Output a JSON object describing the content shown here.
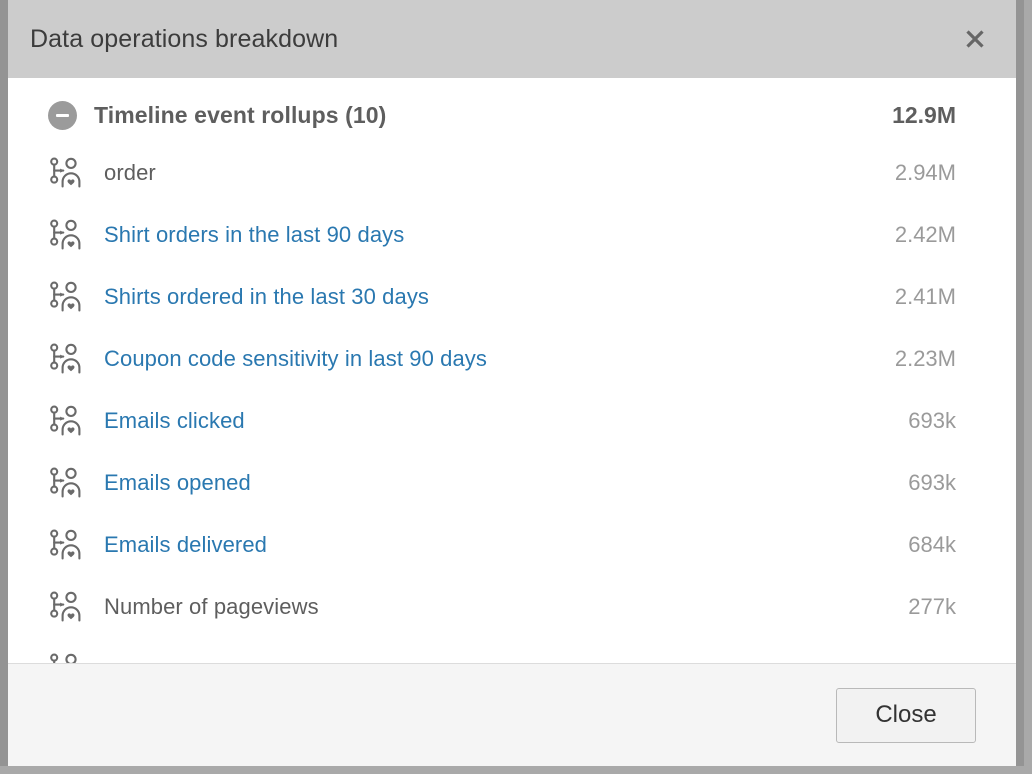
{
  "window": {
    "title": "Data operations breakdown",
    "close_icon": "close-x-icon",
    "border_color": "#949494",
    "header_bg": "#cccccc",
    "body_bg": "#ffffff",
    "footer_bg": "#f5f5f5"
  },
  "group": {
    "toggle_icon": "minus-circle-icon",
    "toggle_state": "expanded",
    "label": "Timeline event rollups (10)",
    "count": 10,
    "total_value": "12.9M"
  },
  "rows": [
    {
      "icon": "timeline-event-person-icon",
      "label": "order",
      "value": "2.94M",
      "is_link": false
    },
    {
      "icon": "timeline-event-person-icon",
      "label": "Shirt orders in the last 90 days",
      "value": "2.42M",
      "is_link": true
    },
    {
      "icon": "timeline-event-person-icon",
      "label": "Shirts ordered in the last 30 days",
      "value": "2.41M",
      "is_link": true
    },
    {
      "icon": "timeline-event-person-icon",
      "label": "Coupon code sensitivity in last 90 days",
      "value": "2.23M",
      "is_link": true
    },
    {
      "icon": "timeline-event-person-icon",
      "label": "Emails clicked",
      "value": "693k",
      "is_link": true
    },
    {
      "icon": "timeline-event-person-icon",
      "label": "Emails opened",
      "value": "693k",
      "is_link": true
    },
    {
      "icon": "timeline-event-person-icon",
      "label": "Emails delivered",
      "value": "684k",
      "is_link": true
    },
    {
      "icon": "timeline-event-person-icon",
      "label": "Number of pageviews",
      "value": "277k",
      "is_link": false
    },
    {
      "icon": "timeline-event-person-icon",
      "label": "",
      "value": "",
      "is_link": false
    }
  ],
  "footer": {
    "close_label": "Close"
  },
  "colors": {
    "link": "#2a78b0",
    "text": "#5e5e5e",
    "muted": "#9a9a9a",
    "title": "#3c3c3c"
  }
}
